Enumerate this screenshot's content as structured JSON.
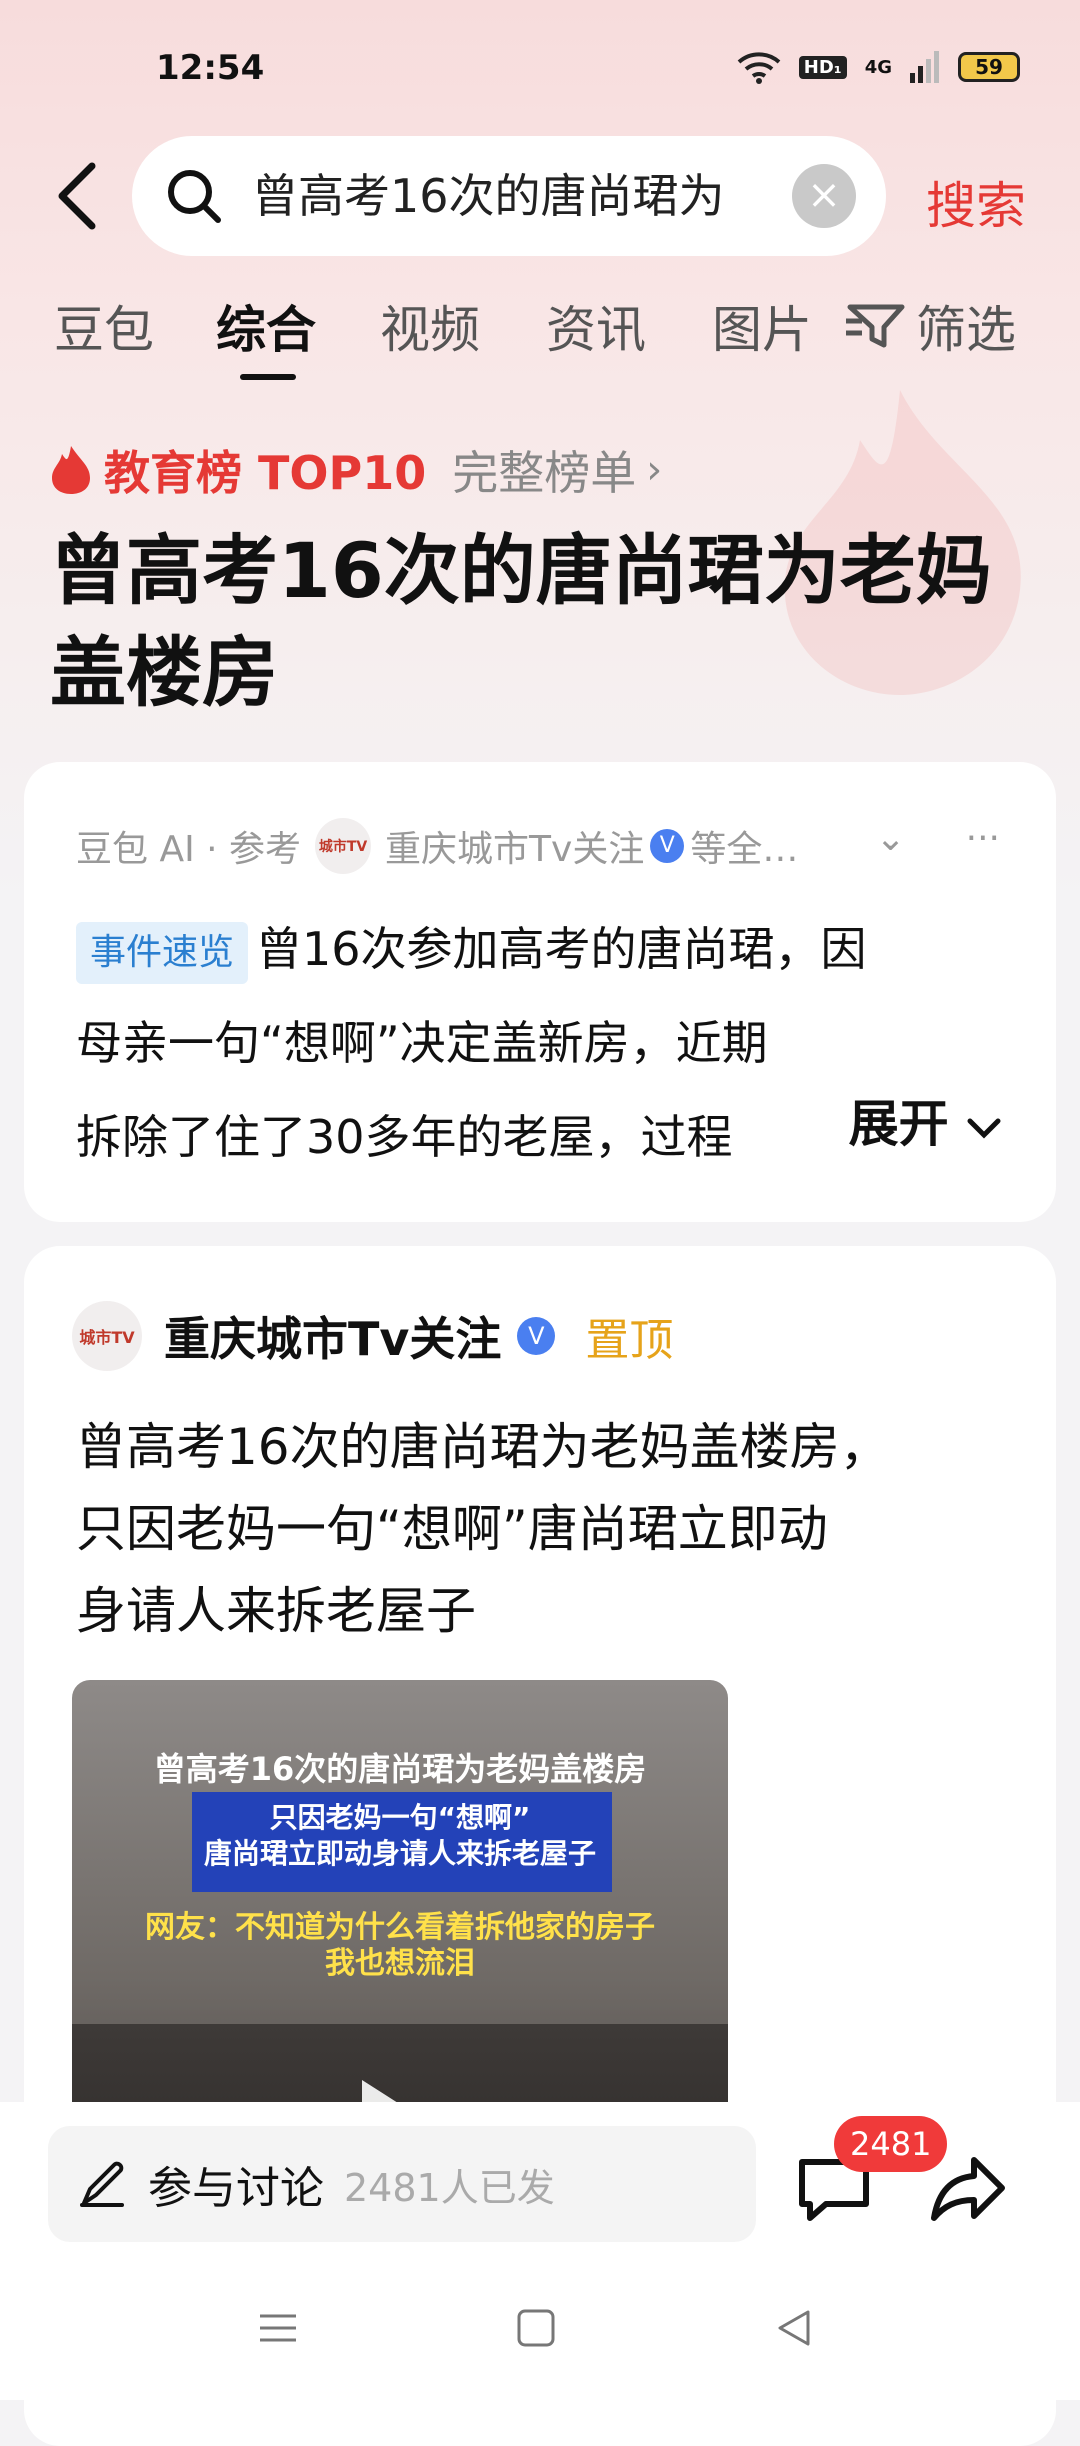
{
  "status_bar": {
    "time": "12:54",
    "network_hd": "HD₁",
    "network_gen": "4G",
    "battery": "59"
  },
  "search": {
    "query": "曾高考16次的唐尚珺为",
    "clear_glyph": "×",
    "submit_label": "搜索"
  },
  "tabs": [
    {
      "label": "豆包"
    },
    {
      "label": "综合"
    },
    {
      "label": "视频"
    },
    {
      "label": "资讯"
    },
    {
      "label": "图片"
    }
  ],
  "filter_label": "筛选",
  "hot_rank": {
    "title": "教育榜 TOP10",
    "full_list": "完整榜单",
    "chevron": "›"
  },
  "headline": "曾高考16次的唐尚珺为老妈盖楼房",
  "ai_card": {
    "source_prefix": "豆包 AI · 参考",
    "source_name": "重庆城市Tv关注",
    "source_suffix": "等全…",
    "logo_text": "城市TV",
    "verify_glyph": "V",
    "dropdown_glyph": "⌄",
    "more_glyph": "···",
    "tag": "事件速览",
    "summary_line1": "曾16次参加高考的唐尚珺，因",
    "summary_line2": "母亲一句“想啊”决定盖新房，近期",
    "summary_line3": "拆除了住了30多年的老屋，过程",
    "expand_label": "展开"
  },
  "post": {
    "avatar_text": "城市TV",
    "author": "重庆城市Tv关注",
    "verify_glyph": "V",
    "pinned_label": "置顶",
    "text_line1": "曾高考16次的唐尚珺为老妈盖楼房，",
    "text_line2": "只因老妈一句“想啊”唐尚珺立即动",
    "text_line3": "身请人来拆老屋子",
    "video": {
      "caption1": "曾高考16次的唐尚珺为老妈盖楼房",
      "caption2": "只因老妈一句“想啊”",
      "caption3": "唐尚珺立即动身请人来拆老屋子",
      "caption4": "网友：不知道为什么看着拆他家的房子",
      "caption5": "我也想流泪"
    }
  },
  "bottom_bar": {
    "discuss_label": "参与讨论",
    "discuss_count": "2481人已发",
    "comment_badge": "2481"
  }
}
